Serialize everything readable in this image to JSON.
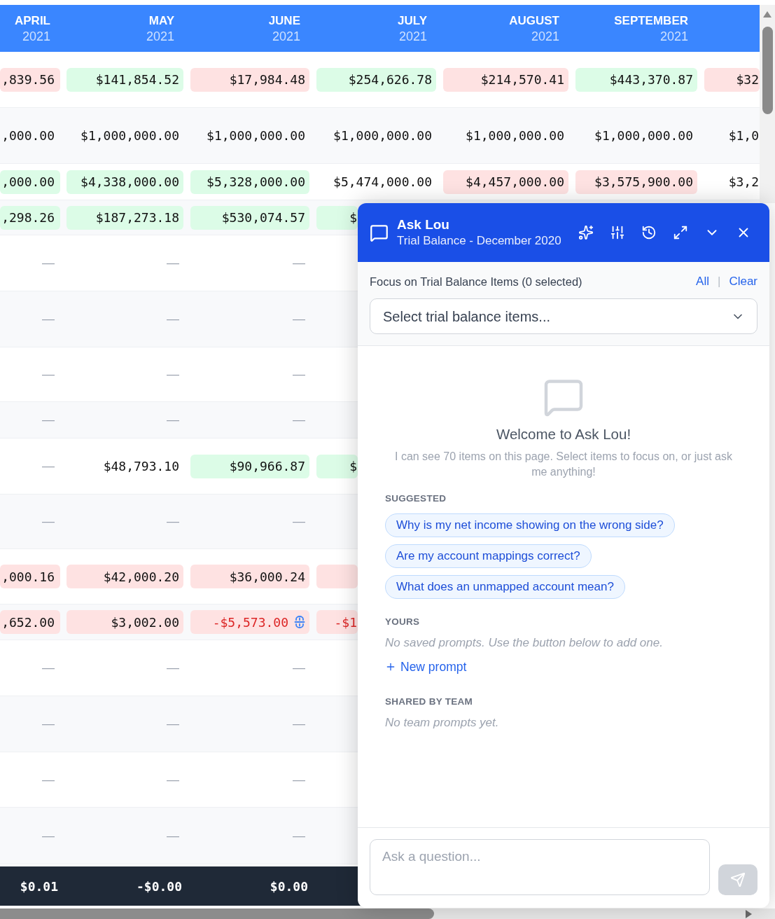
{
  "table": {
    "columns": [
      {
        "month": "APRIL",
        "year": "2021"
      },
      {
        "month": "MAY",
        "year": "2021"
      },
      {
        "month": "JUNE",
        "year": "2021"
      },
      {
        "month": "JULY",
        "year": "2021"
      },
      {
        "month": "AUGUST",
        "year": "2021"
      },
      {
        "month": "SEPTEMBER",
        "year": "2021"
      }
    ],
    "rows": [
      {
        "cells": [
          {
            "value": ",839.56",
            "kind": "amount",
            "color": "#fee2e2",
            "linked": false
          },
          {
            "value": "$141,854.52",
            "kind": "amount",
            "color": "#dcfce7",
            "linked": false
          },
          {
            "value": "$17,984.48",
            "kind": "amount",
            "color": "#fee2e2",
            "linked": false
          },
          {
            "value": "$254,626.78",
            "kind": "amount",
            "color": "#dcfce7",
            "linked": false
          },
          {
            "value": "$214,570.41",
            "kind": "amount",
            "color": "#fee2e2",
            "linked": false
          },
          {
            "value": "$443,370.87",
            "kind": "amount",
            "color": "#dcfce7",
            "linked": false
          },
          {
            "value": "$32",
            "kind": "amount",
            "color": "#fee2e2",
            "linked": false
          }
        ]
      },
      {
        "cells": [
          {
            "value": ",000.00",
            "kind": "amount",
            "linked": false
          },
          {
            "value": "$1,000,000.00",
            "kind": "amount",
            "linked": false
          },
          {
            "value": "$1,000,000.00",
            "kind": "amount",
            "linked": false
          },
          {
            "value": "$1,000,000.00",
            "kind": "amount",
            "linked": false
          },
          {
            "value": "$1,000,000.00",
            "kind": "amount",
            "linked": false
          },
          {
            "value": "$1,000,000.00",
            "kind": "amount",
            "linked": false
          },
          {
            "value": "$1,0",
            "kind": "amount",
            "linked": false
          }
        ]
      },
      {
        "cells": [
          {
            "value": ",000.00",
            "kind": "amount",
            "color": "#dcfce7",
            "linked": false
          },
          {
            "value": "$4,338,000.00",
            "kind": "amount",
            "color": "#dcfce7",
            "linked": false
          },
          {
            "value": "$5,328,000.00",
            "kind": "amount",
            "color": "#dcfce7",
            "linked": false
          },
          {
            "value": "$5,474,000.00",
            "kind": "amount",
            "linked": false
          },
          {
            "value": "$4,457,000.00",
            "kind": "amount",
            "color": "#fee2e2",
            "linked": false
          },
          {
            "value": "$3,575,900.00",
            "kind": "amount",
            "color": "#fee2e2",
            "linked": false
          },
          {
            "value": "$3,2",
            "kind": "amount",
            "linked": false
          }
        ]
      },
      {
        "cells": [
          {
            "value": ",298.26",
            "kind": "amount",
            "color": "#dcfce7",
            "linked": false
          },
          {
            "value": "$187,273.18",
            "kind": "amount",
            "color": "#dcfce7",
            "linked": false
          },
          {
            "value": "$530,074.57",
            "kind": "amount",
            "color": "#dcfce7",
            "linked": false
          },
          {
            "value": "$",
            "kind": "amount",
            "color": "#dcfce7",
            "linked": false
          }
        ]
      },
      {
        "cells": [
          {
            "value": "—",
            "kind": "empty",
            "linked": false
          },
          {
            "value": "—",
            "kind": "empty",
            "linked": false
          },
          {
            "value": "—",
            "kind": "empty",
            "linked": false
          }
        ]
      },
      {
        "cells": [
          {
            "value": "—",
            "kind": "empty",
            "linked": false
          },
          {
            "value": "—",
            "kind": "empty",
            "linked": false
          },
          {
            "value": "—",
            "kind": "empty",
            "linked": false
          }
        ]
      },
      {
        "cells": [
          {
            "value": "—",
            "kind": "empty",
            "linked": false
          },
          {
            "value": "—",
            "kind": "empty",
            "linked": false
          },
          {
            "value": "—",
            "kind": "empty",
            "linked": false
          }
        ]
      },
      {
        "cells": [
          {
            "value": "—",
            "kind": "empty",
            "linked": false
          },
          {
            "value": "—",
            "kind": "empty",
            "linked": false
          },
          {
            "value": "—",
            "kind": "empty",
            "linked": false
          }
        ]
      },
      {
        "cells": [
          {
            "value": "—",
            "kind": "empty",
            "linked": false
          },
          {
            "value": "$48,793.10",
            "kind": "amount",
            "linked": false
          },
          {
            "value": "$90,966.87",
            "kind": "amount",
            "color": "#dcfce7",
            "linked": false
          },
          {
            "value": "$",
            "kind": "amount",
            "color": "#dcfce7",
            "linked": false
          }
        ]
      },
      {
        "cells": [
          {
            "value": "—",
            "kind": "empty",
            "linked": false
          },
          {
            "value": "—",
            "kind": "empty",
            "linked": false
          },
          {
            "value": "—",
            "kind": "empty",
            "linked": false
          }
        ]
      },
      {
        "cells": [
          {
            "value": ",000.16",
            "kind": "amount",
            "color": "#fee2e2",
            "linked": false
          },
          {
            "value": "$42,000.20",
            "kind": "amount",
            "color": "#fee2e2",
            "linked": false
          },
          {
            "value": "$36,000.24",
            "kind": "amount",
            "color": "#fee2e2",
            "linked": false
          },
          {
            "kind": "amount",
            "color": "#fee2e2",
            "linked": false
          }
        ]
      },
      {
        "cells": [
          {
            "value": ",652.00",
            "kind": "amount",
            "color": "#fee2e2",
            "linked": false
          },
          {
            "value": "$3,002.00",
            "kind": "amount",
            "color": "#fee2e2",
            "linked": false
          },
          {
            "value": "-$5,573.00",
            "kind": "negative",
            "color": "#fee2e2",
            "linked": true
          },
          {
            "value": "-$1",
            "kind": "negative",
            "color": "#fee2e2",
            "linked": false
          }
        ]
      },
      {
        "cells": [
          {
            "value": "—",
            "kind": "empty",
            "linked": false
          },
          {
            "value": "—",
            "kind": "empty",
            "linked": false
          },
          {
            "value": "—",
            "kind": "empty",
            "linked": false
          }
        ]
      },
      {
        "cells": [
          {
            "value": "—",
            "kind": "empty",
            "linked": false
          },
          {
            "value": "—",
            "kind": "empty",
            "linked": false
          },
          {
            "value": "—",
            "kind": "empty",
            "linked": false
          }
        ]
      },
      {
        "cells": [
          {
            "value": "—",
            "kind": "empty",
            "linked": false
          },
          {
            "value": "—",
            "kind": "empty",
            "linked": false
          },
          {
            "value": "—",
            "kind": "empty",
            "linked": false
          }
        ]
      },
      {
        "cells": [
          {
            "value": "—",
            "kind": "empty",
            "linked": false
          },
          {
            "value": "—",
            "kind": "empty",
            "linked": false
          },
          {
            "value": "—",
            "kind": "empty",
            "linked": false
          }
        ]
      }
    ],
    "totals": [
      "$0.01",
      "-$0.00",
      "$0.00"
    ]
  },
  "chat_panel": {
    "title": "Ask Lou",
    "subtitle": "Trial Balance - December 2020",
    "focus": {
      "label": "Focus on Trial Balance Items (0 selected)",
      "links": [
        "All",
        "Clear"
      ],
      "separator": "|",
      "select": {
        "placeholder": "Select trial balance items..."
      }
    },
    "welcome": {
      "heading": "Welcome to Ask Lou!",
      "text": "I can see 70 items on this page. Select items to focus on, or just ask me anything!"
    },
    "sections": [
      {
        "heading": "SUGGESTED",
        "prompts": [
          "Why is my net income showing on the wrong side?",
          "Are my account mappings correct?",
          "What does an unmapped account mean?"
        ]
      },
      {
        "heading": "YOURS",
        "empty_text": "No saved prompts. Use the button below to add one.",
        "action": "New prompt"
      },
      {
        "heading": "SHARED BY TEAM",
        "empty_text": "No team prompts yet."
      }
    ],
    "composer": {
      "placeholder": "Ask a question...",
      "send_button": {
        "disabled": true
      }
    }
  }
}
